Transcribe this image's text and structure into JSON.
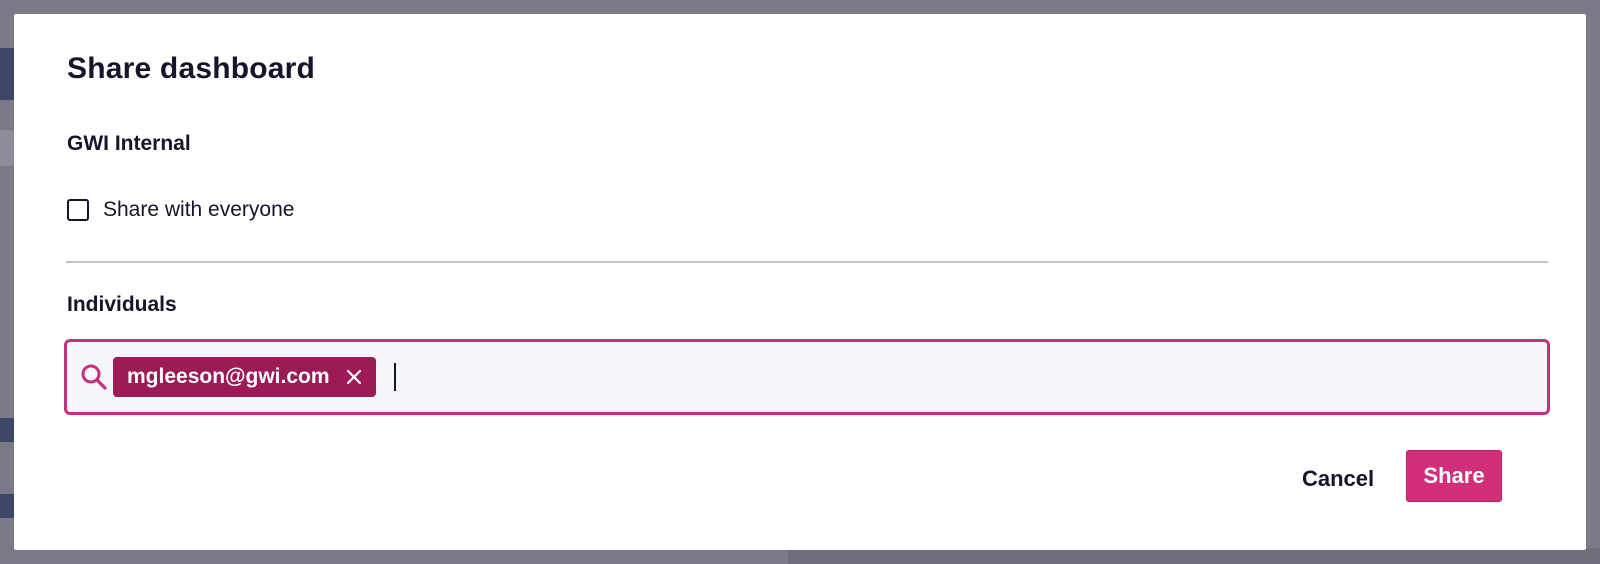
{
  "dialog": {
    "title": "Share dashboard"
  },
  "internal": {
    "heading": "GWI Internal",
    "share_everyone_label": "Share with everyone",
    "share_everyone_checked": false
  },
  "individuals": {
    "heading": "Individuals",
    "chips": [
      "mgleeson@gwi.com"
    ],
    "input_value": ""
  },
  "actions": {
    "cancel_label": "Cancel",
    "share_label": "Share"
  },
  "icons": {
    "search": "search-icon",
    "chip_remove": "close-icon"
  },
  "colors": {
    "accent": "#d22e7a",
    "chip": "#9c1a55",
    "focus_border": "#c6307a",
    "text": "#14142b"
  }
}
